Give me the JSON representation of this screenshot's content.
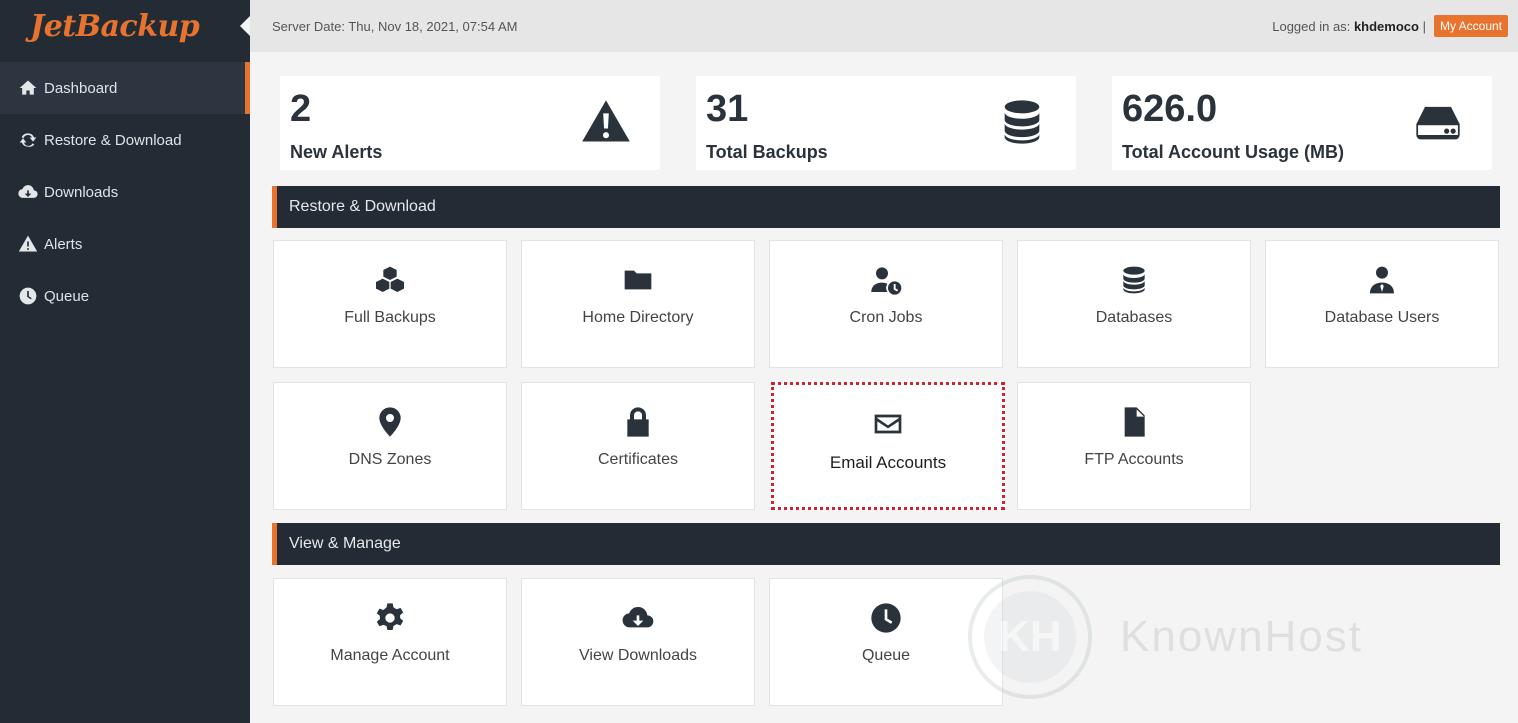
{
  "app": {
    "logo_text": "JetBackup"
  },
  "sidebar": {
    "items": [
      {
        "label": "Dashboard",
        "icon": "home-icon",
        "active": true
      },
      {
        "label": "Restore & Download",
        "icon": "refresh-icon",
        "active": false
      },
      {
        "label": "Downloads",
        "icon": "cloud-download-icon",
        "active": false
      },
      {
        "label": "Alerts",
        "icon": "warning-icon",
        "active": false
      },
      {
        "label": "Queue",
        "icon": "clock-icon",
        "active": false
      }
    ]
  },
  "topbar": {
    "server_date": "Server Date: Thu, Nov 18, 2021, 07:54 AM",
    "logged_in_prefix": "Logged in as:",
    "username": "khdemoco",
    "separator": "|",
    "my_account_label": "My Account"
  },
  "stats": [
    {
      "value": "2",
      "label": "New Alerts",
      "icon": "warning-icon"
    },
    {
      "value": "31",
      "label": "Total Backups",
      "icon": "database-icon"
    },
    {
      "value": "626.0",
      "label": "Total Account Usage (MB)",
      "icon": "hard-drive-icon"
    }
  ],
  "sections": {
    "restore_download": {
      "title": "Restore & Download",
      "tiles": [
        {
          "label": "Full Backups",
          "icon": "cubes-icon"
        },
        {
          "label": "Home Directory",
          "icon": "folder-icon"
        },
        {
          "label": "Cron Jobs",
          "icon": "user-clock-icon"
        },
        {
          "label": "Databases",
          "icon": "database-icon"
        },
        {
          "label": "Database Users",
          "icon": "user-tie-icon"
        },
        {
          "label": "DNS Zones",
          "icon": "map-marker-icon"
        },
        {
          "label": "Certificates",
          "icon": "lock-icon"
        },
        {
          "label": "Email Accounts",
          "icon": "envelope-icon",
          "highlighted": true
        },
        {
          "label": "FTP Accounts",
          "icon": "file-icon"
        }
      ]
    },
    "view_manage": {
      "title": "View & Manage",
      "tiles": [
        {
          "label": "Manage Account",
          "icon": "gear-icon"
        },
        {
          "label": "View Downloads",
          "icon": "cloud-download-icon"
        },
        {
          "label": "Queue",
          "icon": "clock-icon"
        }
      ]
    }
  },
  "watermark": {
    "letter": "KH",
    "text": "KnownHost"
  },
  "colors": {
    "accent": "#e8732e",
    "sidebar_bg": "#232c35",
    "highlight_border": "#d2222d"
  }
}
